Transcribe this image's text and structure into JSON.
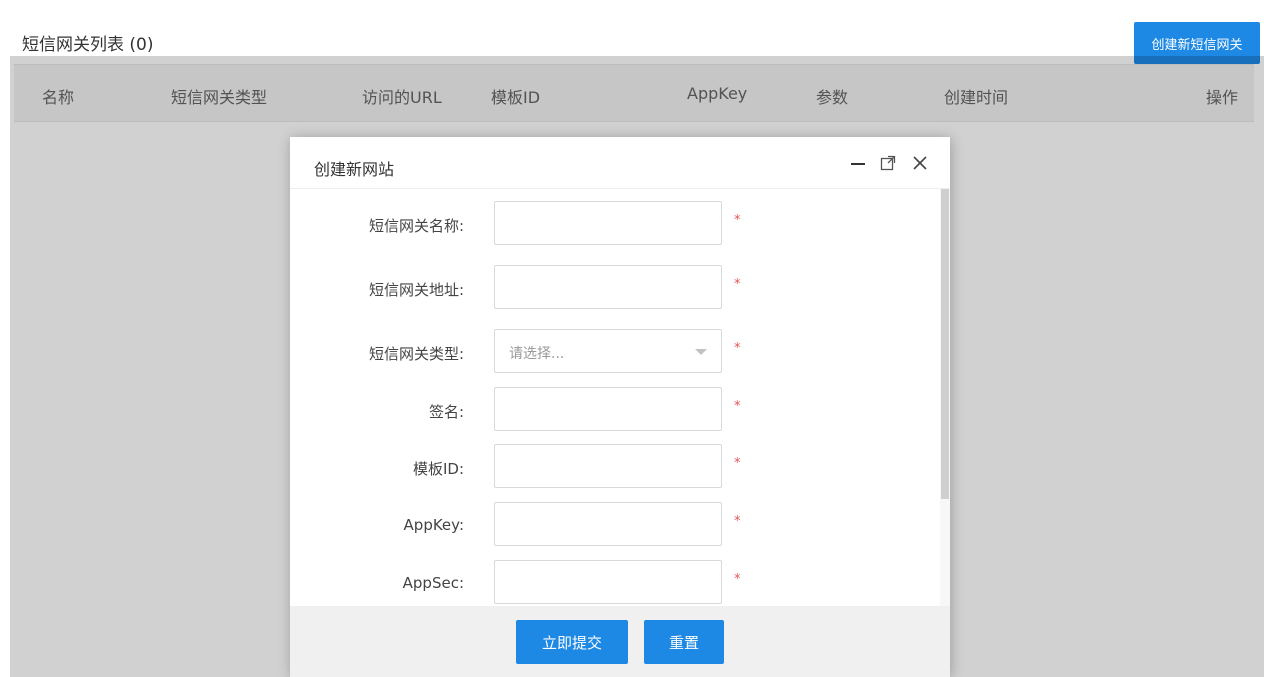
{
  "page": {
    "title": "短信网关列表 (0)",
    "create_button": "创建新短信网关"
  },
  "table": {
    "columns": [
      "名称",
      "短信网关类型",
      "访问的URL",
      "模板ID",
      "AppKey",
      "参数",
      "创建时间",
      "操作"
    ]
  },
  "dialog": {
    "title": "创建新网站",
    "controls": {
      "minimize_icon": "minimize-icon",
      "maximize_icon": "maximize-icon",
      "close_icon": "close-icon"
    },
    "fields": [
      {
        "label": "短信网关名称:",
        "value": "",
        "type": "text",
        "required_mark": "*"
      },
      {
        "label": "短信网关地址:",
        "value": "",
        "type": "text",
        "required_mark": "*"
      },
      {
        "label": "短信网关类型:",
        "placeholder": "请选择...",
        "type": "select",
        "required_mark": "*"
      },
      {
        "label": "签名:",
        "value": "",
        "type": "text",
        "required_mark": "*"
      },
      {
        "label": "模板ID:",
        "value": "",
        "type": "text",
        "required_mark": "*"
      },
      {
        "label": "AppKey:",
        "value": "",
        "type": "text",
        "required_mark": "*"
      },
      {
        "label": "AppSec:",
        "value": "",
        "type": "text",
        "required_mark": "*"
      }
    ],
    "submit_button": "立即提交",
    "reset_button": "重置"
  },
  "colors": {
    "primary": "#1e88e5",
    "required": "#e05555",
    "overlay": "rgba(0,0,0,0.18)"
  }
}
